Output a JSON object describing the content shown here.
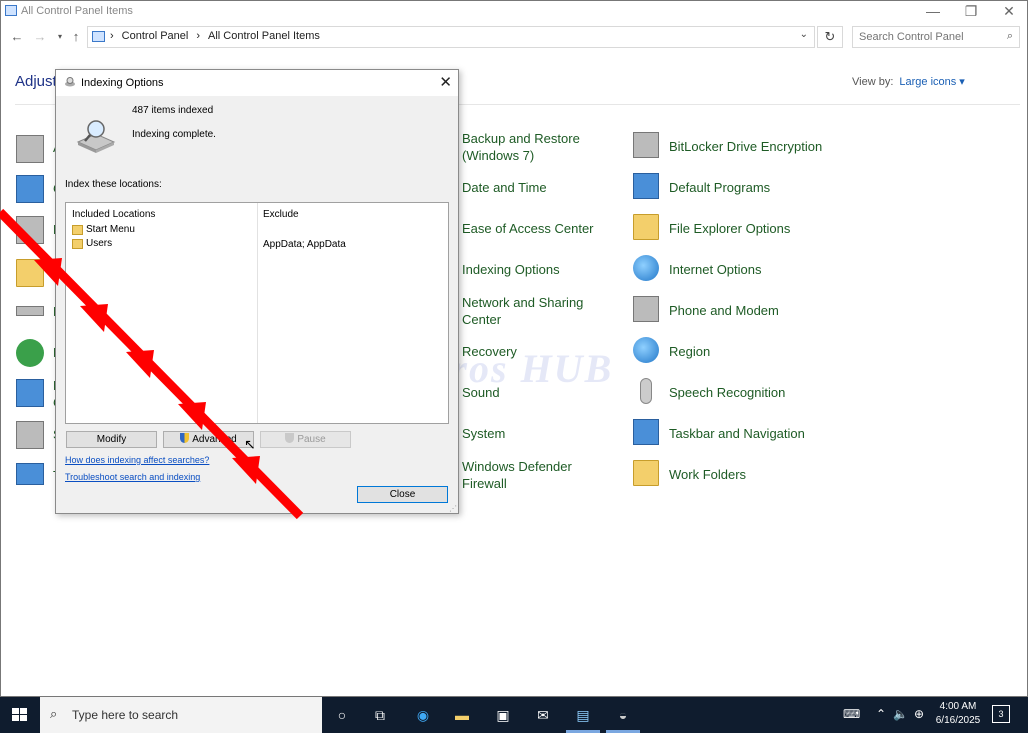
{
  "window": {
    "title": "All Control Panel Items",
    "controls": {
      "minimize": "—",
      "restore": "❐",
      "close": "✕"
    }
  },
  "address": {
    "breadcrumbs": [
      "Control Panel",
      "All Control Panel Items"
    ],
    "search_placeholder": "Search Control Panel"
  },
  "header": {
    "adjust_text": "Adjust y",
    "viewby_label": "View by:",
    "viewby_value": "Large icons ▾"
  },
  "left_partial_items": [
    {
      "label": "A",
      "icon": "administrative-tools-icon"
    },
    {
      "label": "C",
      "icon": "color-management-icon"
    },
    {
      "label": "D",
      "icon": "devices-and-printers-icon"
    },
    {
      "label": "F",
      "icon": "folder-icon"
    },
    {
      "label": "K",
      "icon": "keyboard-icon"
    },
    {
      "label": "P",
      "icon": "power-options-icon"
    },
    {
      "label": "P",
      "icon": "programs-icon"
    },
    {
      "label": "C",
      "icon": "programs-icon-sub"
    },
    {
      "label": "S",
      "icon": "storage-spaces-icon"
    },
    {
      "label": "T",
      "icon": "troubleshooting-icon"
    }
  ],
  "col2_items": [
    {
      "label": "Backup and Restore (Windows 7)"
    },
    {
      "label": "Date and Time"
    },
    {
      "label": "Ease of Access Center"
    },
    {
      "label": "Indexing Options"
    },
    {
      "label": "Network and Sharing Center"
    },
    {
      "label": "Recovery"
    },
    {
      "label": "Sound"
    },
    {
      "label": "System"
    },
    {
      "label": "Windows Defender Firewall"
    }
  ],
  "col3_items": [
    {
      "label": "BitLocker Drive Encryption"
    },
    {
      "label": "Default Programs"
    },
    {
      "label": "File Explorer Options"
    },
    {
      "label": "Internet Options"
    },
    {
      "label": "Phone and Modem"
    },
    {
      "label": "Region"
    },
    {
      "label": "Speech Recognition"
    },
    {
      "label": "Taskbar and Navigation"
    },
    {
      "label": "Work Folders"
    }
  ],
  "watermark": "IT Pros HUB",
  "dialog": {
    "title": "Indexing Options",
    "items_indexed": "487 items indexed",
    "status": "Indexing complete.",
    "index_label": "Index these locations:",
    "included_header": "Included Locations",
    "exclude_header": "Exclude",
    "locations": [
      {
        "name": "Start Menu",
        "exclude": ""
      },
      {
        "name": "Users",
        "exclude": "AppData; AppData"
      }
    ],
    "buttons": {
      "modify": "Modify",
      "advanced": "Advanced",
      "pause": "Pause",
      "close": "Close"
    },
    "links": {
      "how": "How does indexing affect searches?",
      "troubleshoot": "Troubleshoot search and indexing"
    }
  },
  "taskbar": {
    "search_placeholder": "Type here to search",
    "time": "4:00 AM",
    "date": "6/16/2025",
    "notifications": "3"
  }
}
